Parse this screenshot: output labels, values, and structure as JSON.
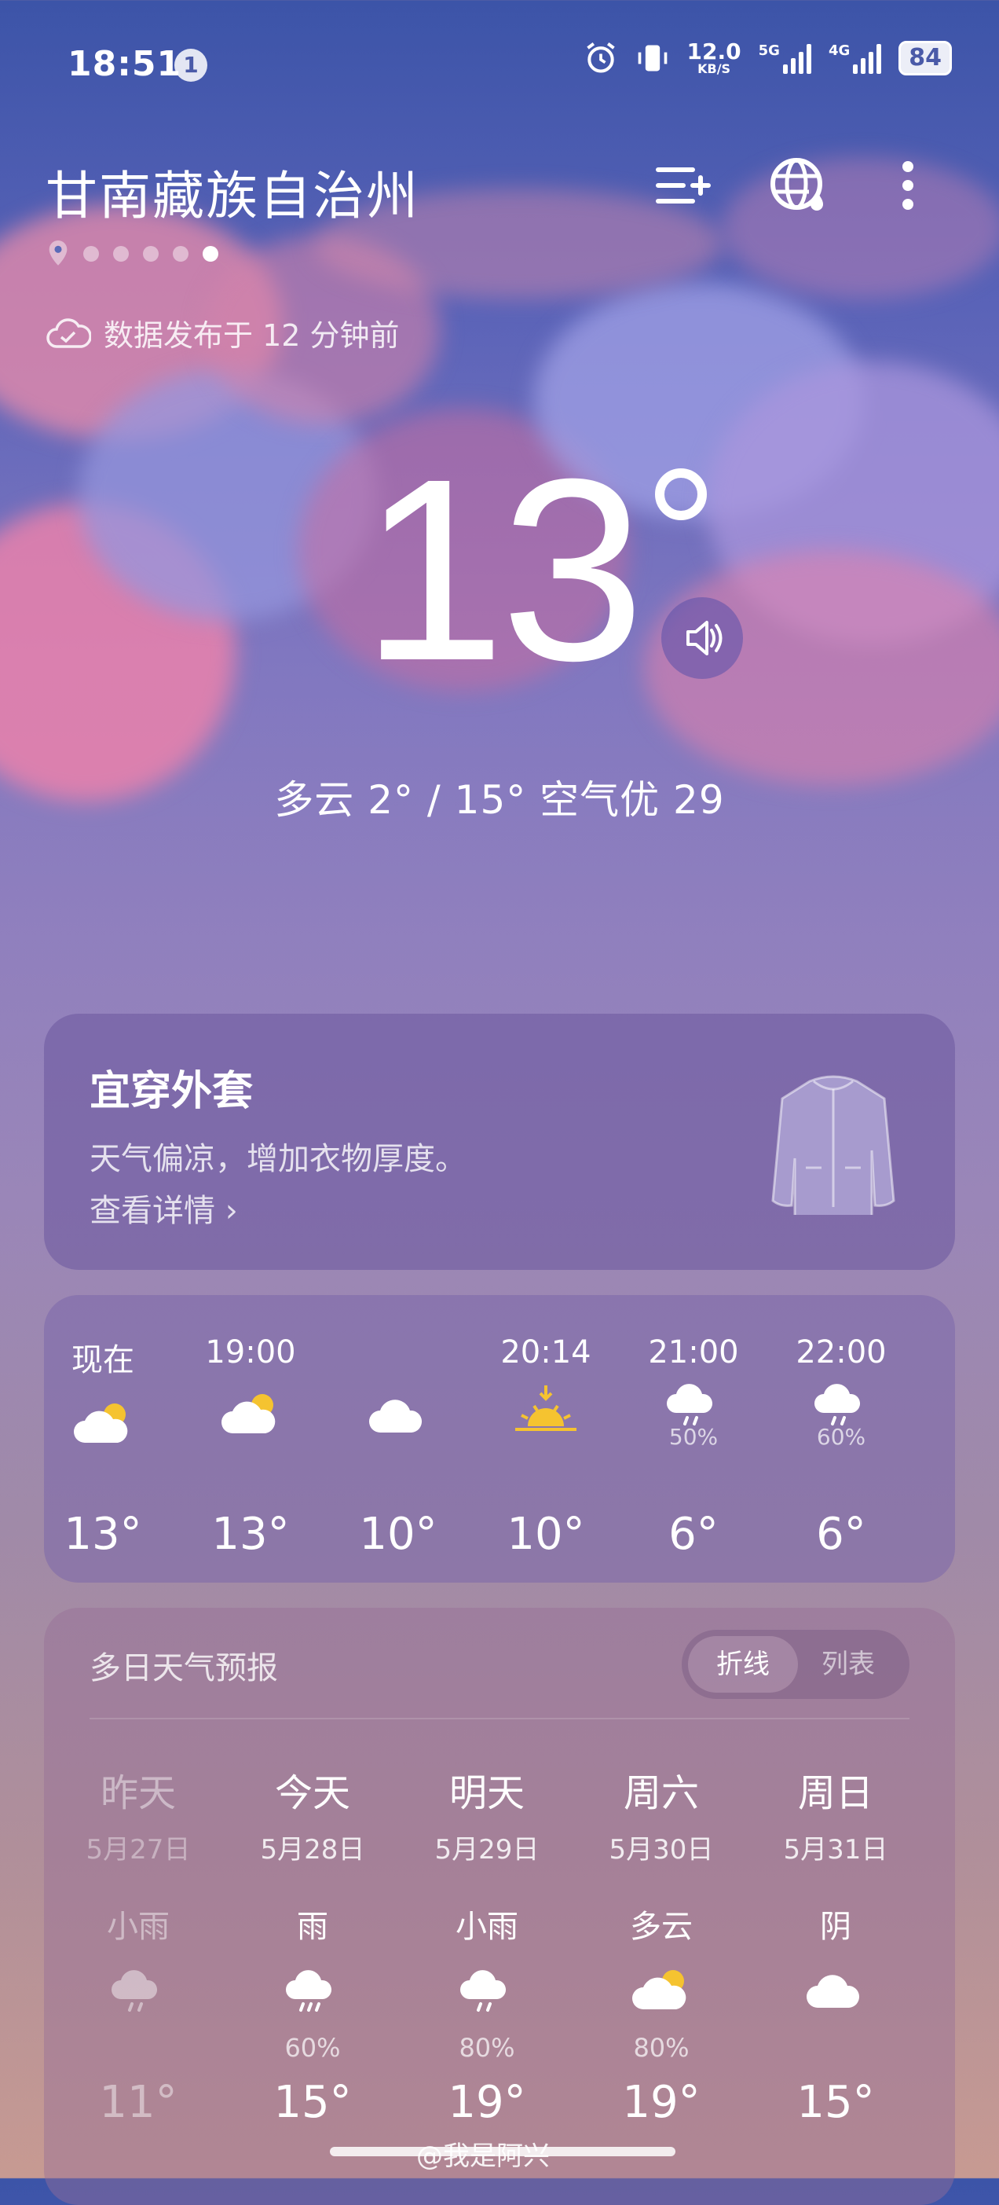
{
  "status_bar": {
    "time": "18:51",
    "notification_count": "1",
    "net_speed": "12.0",
    "net_unit": "KB/S",
    "sim1": "5G",
    "sim2": "4G",
    "battery": "84"
  },
  "header": {
    "city": "甘南藏族自治州",
    "page_count": 5,
    "active_page": 5,
    "published": "数据发布于 12 分钟前"
  },
  "current": {
    "temperature": "13",
    "summary": "多云  2° / 15°  空气优 29"
  },
  "clothing": {
    "title": "宜穿外套",
    "description": "天气偏凉，增加衣物厚度。",
    "link": "查看详情 ›"
  },
  "hourly": [
    {
      "label": "现在",
      "icon": "partly-cloudy-icon",
      "precip": "",
      "temp": "13°"
    },
    {
      "label": "19:00",
      "icon": "partly-cloudy-icon",
      "precip": "",
      "temp": "13°"
    },
    {
      "label": "",
      "icon": "cloudy-icon",
      "precip": "",
      "temp": "10°"
    },
    {
      "label": "20:14",
      "icon": "sunset-icon",
      "precip": "",
      "temp": "10°"
    },
    {
      "label": "21:00",
      "icon": "light-rain-icon",
      "precip": "50%",
      "temp": "6°"
    },
    {
      "label": "22:00",
      "icon": "light-rain-icon",
      "precip": "60%",
      "temp": "6°"
    }
  ],
  "daily": {
    "title": "多日天气预报",
    "toggle_line": "折线",
    "toggle_list": "列表",
    "days": [
      {
        "day": "昨天",
        "date": "5月27日",
        "condition": "小雨",
        "icon": "light-rain-icon",
        "precip": "",
        "temp": "11°",
        "dim": true
      },
      {
        "day": "今天",
        "date": "5月28日",
        "condition": "雨",
        "icon": "rain-icon",
        "precip": "60%",
        "temp": "15°",
        "dim": false
      },
      {
        "day": "明天",
        "date": "5月29日",
        "condition": "小雨",
        "icon": "light-rain-icon",
        "precip": "80%",
        "temp": "19°",
        "dim": false
      },
      {
        "day": "周六",
        "date": "5月30日",
        "condition": "多云",
        "icon": "partly-cloudy-icon",
        "precip": "80%",
        "temp": "19°",
        "dim": false
      },
      {
        "day": "周日",
        "date": "5月31日",
        "condition": "阴",
        "icon": "cloudy-icon",
        "precip": "",
        "temp": "15°",
        "dim": false
      }
    ]
  },
  "watermark": "@我是阿兴"
}
